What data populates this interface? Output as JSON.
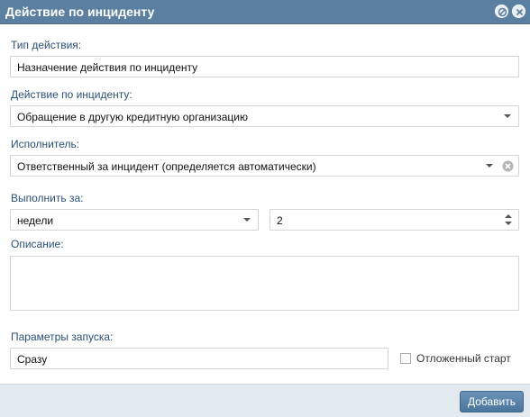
{
  "dialog": {
    "title": "Действие по инциденту"
  },
  "form": {
    "action_type": {
      "label": "Тип действия:",
      "value": "Назначение действия по инциденту"
    },
    "incident_action": {
      "label": "Действие по инциденту:",
      "value": "Обращение в другую кредитную организацию"
    },
    "executor": {
      "label": "Исполнитель:",
      "value": "Ответственный за инцидент (определяется автоматически)"
    },
    "complete_in": {
      "label": "Выполнить за:",
      "unit_value": "недели",
      "amount_value": "2"
    },
    "description": {
      "label": "Описание:",
      "value": ""
    },
    "launch_params": {
      "label": "Параметры запуска:",
      "value": "Сразу"
    },
    "deferred_start": {
      "label": "Отложенный старт",
      "checked": false
    }
  },
  "footer": {
    "add_label": "Добавить"
  },
  "icons": {
    "title_minimize": "circle-slash-icon",
    "title_close": "close-icon",
    "dropdown": "triangle-down-icon",
    "clear": "circle-x-icon",
    "stepper": "up-down-arrows-icon"
  }
}
